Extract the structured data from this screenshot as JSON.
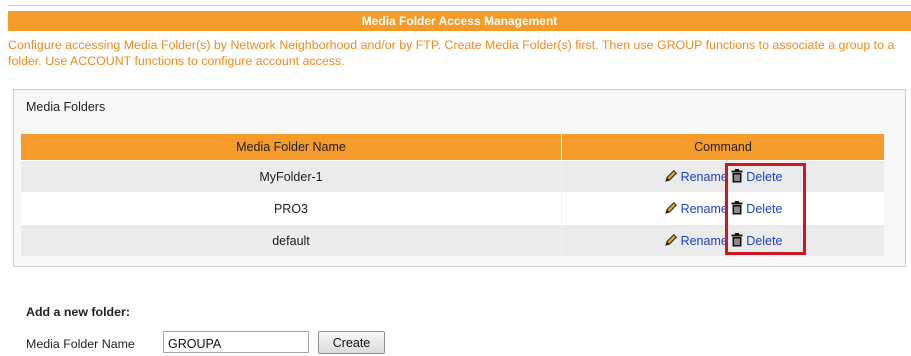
{
  "header": {
    "title": "Media Folder Access Management"
  },
  "intro": {
    "text": "Configure accessing Media Folder(s) by Network Neighborhood and/or by FTP. Create Media Folder(s) first. Then use GROUP functions to associate a group to a folder. Use ACCOUNT functions to configure account access."
  },
  "media_folders": {
    "title": "Media Folders",
    "columns": {
      "name": "Media Folder Name",
      "command": "Command"
    },
    "rows": [
      {
        "name": "MyFolder-1",
        "rename": "Rename",
        "delete": "Delete"
      },
      {
        "name": "PRO3",
        "rename": "Rename",
        "delete": "Delete"
      },
      {
        "name": "default",
        "rename": "Rename",
        "delete": "Delete"
      }
    ],
    "icons": {
      "rename": "pencil-icon",
      "delete": "trash-icon"
    }
  },
  "add_folder": {
    "title": "Add a new folder:",
    "label": "Media Folder Name",
    "value": "GROUPA",
    "button": "Create"
  },
  "colors": {
    "header_bg": "#f59b2a",
    "intro_text": "#f08a1d",
    "link": "#1f3fc8",
    "highlight": "#c81a24"
  }
}
